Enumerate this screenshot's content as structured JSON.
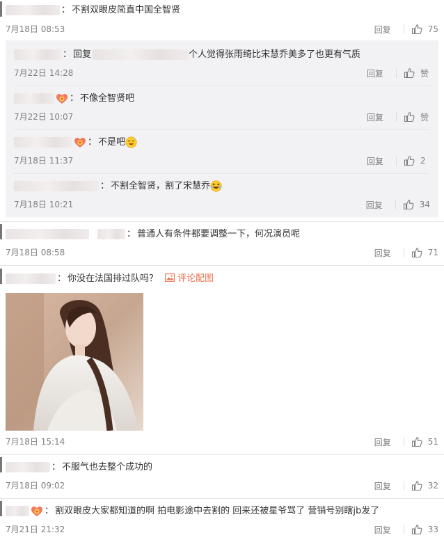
{
  "comments": [
    {
      "text": "不割双眼皮简直中国全智贤",
      "time": "7月18日 08:53",
      "reply": "回复",
      "likes": "75"
    },
    {
      "reply_prefix": "回复",
      "text": "个人觉得张雨绮比宋慧乔美多了也更有气质",
      "time": "7月22日 14:28",
      "reply": "回复",
      "likes": "赞"
    },
    {
      "text": "不像全智贤吧",
      "time": "7月22日 10:07",
      "reply": "回复",
      "likes": "赞"
    },
    {
      "text": "不是吧",
      "time": "7月18日 11:37",
      "reply": "回复",
      "likes": "2"
    },
    {
      "text": "不割全智贤，割了宋慧乔",
      "time": "7月18日 10:21",
      "reply": "回复",
      "likes": "34"
    },
    {
      "text": "普通人有条件都要调整一下，何况演员呢",
      "time": "7月18日 08:58",
      "reply": "回复",
      "likes": "71"
    },
    {
      "text": "你没在法国排过队吗？",
      "pic_link": "评论配图",
      "time": "7月18日 15:14",
      "reply": "回复",
      "likes": "51"
    },
    {
      "text": "不服气也去整个成功的",
      "time": "7月18日 09:02",
      "reply": "回复",
      "likes": "32"
    },
    {
      "text": "割双眼皮大家都知道的啊 拍电影途中去割的 回来还被星爷骂了 营销号别瞎jb发了",
      "time": "7月21日 21:32",
      "reply": "回复",
      "likes": "33"
    }
  ],
  "icons": {
    "like": "thumbs-up-icon",
    "picture": "image-icon",
    "emoji_sweat": "sweat-smile-emoji",
    "emoji_laugh": "laugh-tears-emoji",
    "badge": "vip-heart-badge-icon"
  }
}
